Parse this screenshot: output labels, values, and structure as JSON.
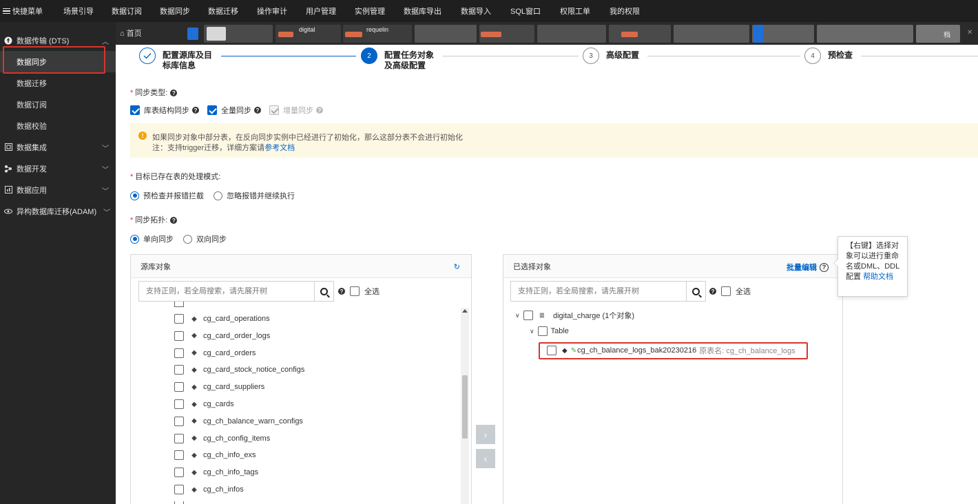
{
  "topnav": {
    "menu_label": "快捷菜单",
    "items": [
      "场景引导",
      "数据订阅",
      "数据同步",
      "数据迁移",
      "操作审计",
      "用户管理",
      "实例管理",
      "数据库导出",
      "数据导入",
      "SQL窗口",
      "权限工单",
      "我的权限"
    ]
  },
  "sidebar": {
    "groups": [
      {
        "label": "数据传输 (DTS)",
        "expanded": true
      },
      {
        "label": "数据集成"
      },
      {
        "label": "数据开发"
      },
      {
        "label": "数据应用"
      },
      {
        "label": "异构数据库迁移(ADAM)"
      }
    ],
    "dts_items": [
      "数据同步",
      "数据迁移",
      "数据订阅",
      "数据校验"
    ],
    "active_item": "数据同步"
  },
  "tabs": {
    "home": "首页",
    "t1": "digital",
    "t2": "requelin",
    "t3": "档"
  },
  "steps": [
    {
      "num": "",
      "label": "配置源库及目\n标库信息",
      "state": "done"
    },
    {
      "num": "2",
      "label": "配置任务对象\n及高级配置",
      "state": "current"
    },
    {
      "num": "3",
      "label": "高级配置",
      "state": "todo"
    },
    {
      "num": "4",
      "label": "预检查",
      "state": "todo"
    }
  ],
  "sync_type": {
    "label": "同步类型:",
    "options": [
      {
        "label": "库表结构同步",
        "checked": true
      },
      {
        "label": "全量同步",
        "checked": true
      },
      {
        "label": "增量同步",
        "checked": true,
        "disabled": true
      }
    ]
  },
  "notice": {
    "line1": "如果同步对象中部分表，在反向同步实例中已经进行了初始化，那么这部分表不会进行初始化",
    "line2_prefix": "注：支持trigger迁移，详细方案请",
    "line2_link": "参考文档"
  },
  "target_mode": {
    "label": "目标已存在表的处理模式:",
    "options": [
      "预检查并报错拦截",
      "忽略报错并继续执行"
    ],
    "selected": "预检查并报错拦截"
  },
  "topology": {
    "label": "同步拓扑:",
    "options": [
      "单向同步",
      "双向同步"
    ],
    "selected": "单向同步"
  },
  "source_panel": {
    "title": "源库对象",
    "search_placeholder": "支持正则，若全局搜索，请先展开树",
    "select_all": "全选",
    "tables": [
      "cg_card_operations",
      "cg_card_order_logs",
      "cg_card_orders",
      "cg_card_stock_notice_configs",
      "cg_card_suppliers",
      "cg_cards",
      "cg_ch_balance_warn_configs",
      "cg_ch_config_items",
      "cg_ch_info_exs",
      "cg_ch_info_tags",
      "cg_ch_infos"
    ]
  },
  "selected_panel": {
    "title": "已选择对象",
    "batch_edit": "批量编辑",
    "search_placeholder": "支持正则，若全局搜索，请先展开树",
    "select_all": "全选",
    "db_node": "digital_charge (1个对象)",
    "table_node": "Table",
    "item_name": "cg_ch_balance_logs_bak20230216",
    "item_orig": "原表名: cg_ch_balance_logs"
  },
  "tooltip": {
    "line1": "【右键】选择对",
    "line2": "象可以进行重命",
    "line3": "名或DML、DDL",
    "line4_prefix": "配置 ",
    "line4_link": "帮助文档"
  },
  "colors": {
    "accent": "#0064c8",
    "danger": "#d9342b",
    "warn": "#f4a20b"
  }
}
